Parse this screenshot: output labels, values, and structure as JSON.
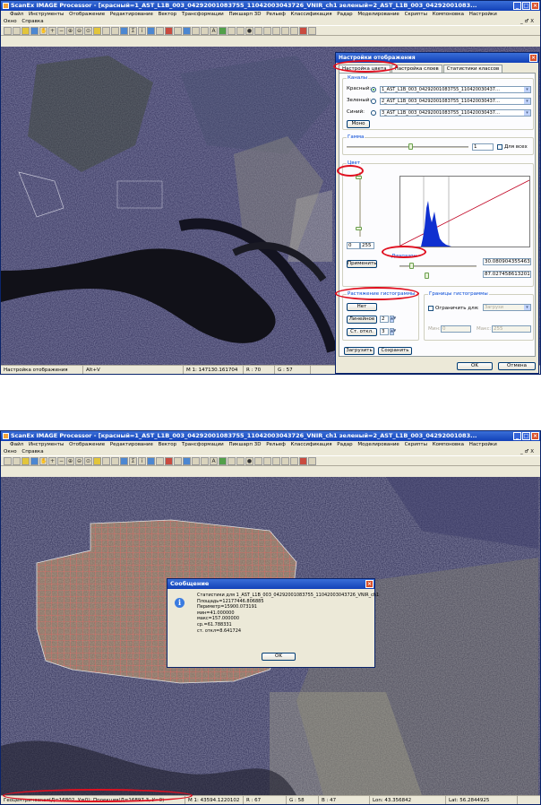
{
  "window1": {
    "title": "ScanEx IMAGE Processor - [красный=1_AST_L1B_003_04292001083755_11042003043726_VNIR_ch1 зеленый=2_AST_L1B_003_04292001083...",
    "menu": [
      "Файл",
      "Инструменты",
      "Отображение",
      "Редактирование",
      "Вектор",
      "Трансформации",
      "Пикшарп 3D",
      "Рельеф",
      "Классификация",
      "Радар",
      "Моделирование",
      "Скрипты",
      "Компоновка",
      "Настройки"
    ],
    "menu2": [
      "Окно",
      "Справка"
    ],
    "mdi_controls": "_ ♂ X",
    "status": [
      "Настройка отображения",
      "Alt+V",
      "M 1: 147130.161704",
      "R : 70",
      "G : 57"
    ]
  },
  "dialog": {
    "title": "Настройки отображения",
    "tabs": [
      "Настройка цвета",
      "Настройка слоев",
      "Статистики классов"
    ],
    "channels_group": "Каналы",
    "channels": [
      {
        "label": "Красный:",
        "value": "1_AST_L1B_003_04292001083755_110420030437…",
        "checked": true
      },
      {
        "label": "Зеленый:",
        "value": "2_AST_L1B_003_04292001083755_110420030437…",
        "checked": false
      },
      {
        "label": "Синий:",
        "value": "3_AST_L1B_003_04292001083755_110420030437…",
        "checked": false
      }
    ],
    "mono_button": "Моно",
    "gamma_group": "Гамма",
    "gamma_value": "1",
    "for_all_label": "Для всех",
    "color_group": "Цвет",
    "range_low": "0",
    "range_high": "255",
    "apply_button": "Применить",
    "range_label": "Диапазон",
    "range_values": [
      "30.080904355463",
      "87.027458613201"
    ],
    "stretch_group": "Растяжение гистограммы",
    "stretch_buttons": [
      "Нет",
      "Линейное",
      "Ст. откл."
    ],
    "stretch_spins": [
      "2",
      "3"
    ],
    "bounds_group": "Границы гистограммы",
    "limit_label": "Ограничить для:",
    "limit_select": "Загрузи",
    "min_label": "Мин:",
    "min_value": "0",
    "max_label": "Макс:",
    "max_value": "255",
    "load_button": "Загрузить",
    "save_button": "Сохранить",
    "ok_button": "OK",
    "cancel_button": "Отмена"
  },
  "window2": {
    "title": "ScanEx IMAGE Processor - [красный=1_AST_L1B_003_04292001083755_11042003043726_VNIR_ch1 зеленый=2_AST_L1B_003_04292001083...",
    "status": [
      "Геоцентрическая(Д=16802, У=0); Проекция(Д=16897.3, У=0)",
      "M 1: 43594.1220102",
      "R : 67",
      "G : 58",
      "B : 47",
      "Lon: 43.356842",
      "Lat: 56.2844925"
    ]
  },
  "message": {
    "title": "Сообщение",
    "lines": [
      "Статистики для 1_AST_L1B_003_04292001083755_11042003043726_VNIR_ch1",
      "Площадь=12177446.806885",
      "Периметр=15900.073191",
      "мин=41.000000",
      "макс=157.000000",
      "ср.=61.788331",
      "ст. откл=8.641724"
    ],
    "ok_button": "OK"
  },
  "colors": {
    "titlebar": "#1a4fc4",
    "annotation_red": "#e01020",
    "link_blue": "#0046d5"
  }
}
